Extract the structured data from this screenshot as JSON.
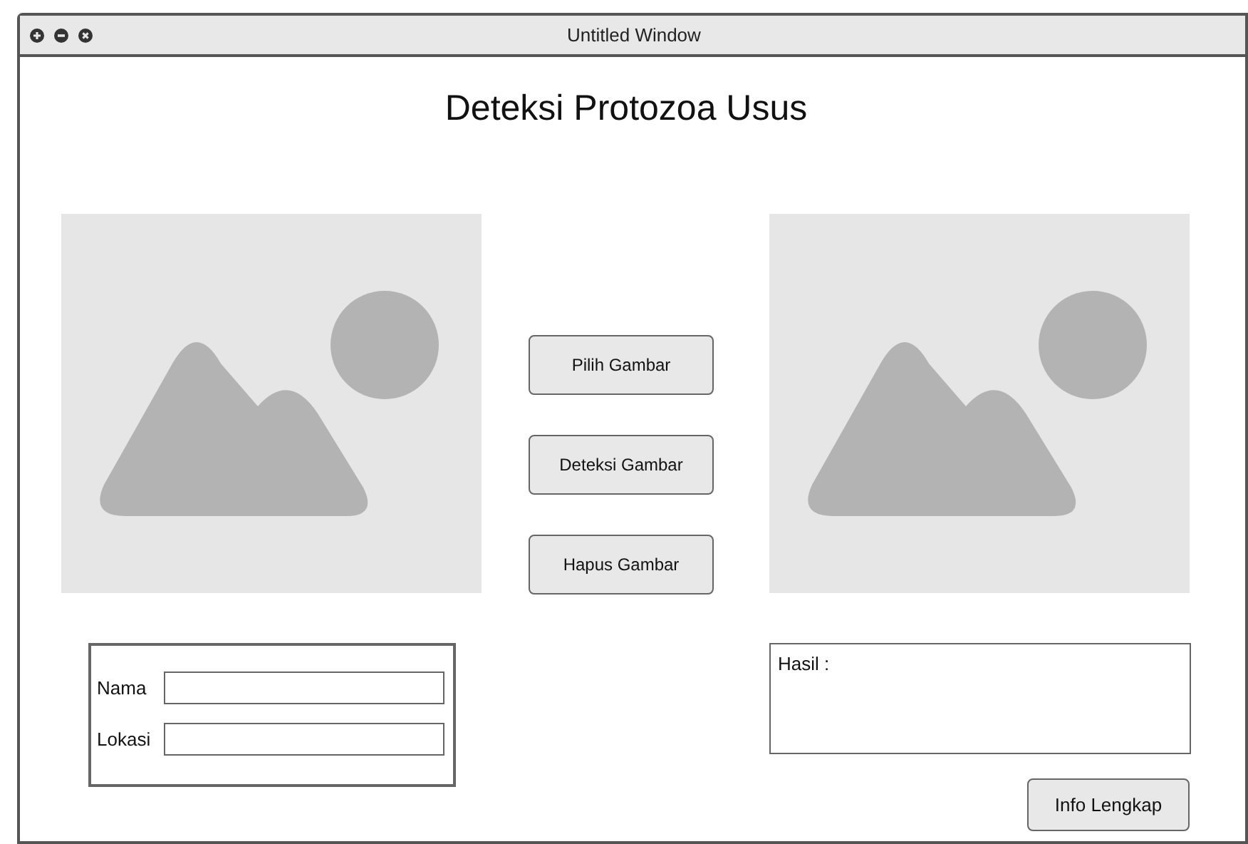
{
  "window": {
    "title": "Untitled Window"
  },
  "heading": "Deteksi Protozoa Usus",
  "actions": [
    {
      "label": "Pilih Gambar"
    },
    {
      "label": "Deteksi Gambar"
    },
    {
      "label": "Hapus Gambar"
    }
  ],
  "form": {
    "fields": [
      {
        "label": "Nama"
      },
      {
        "label": "Lokasi"
      }
    ]
  },
  "result": {
    "label": "Hasil :"
  },
  "info_button": "Info Lengkap"
}
